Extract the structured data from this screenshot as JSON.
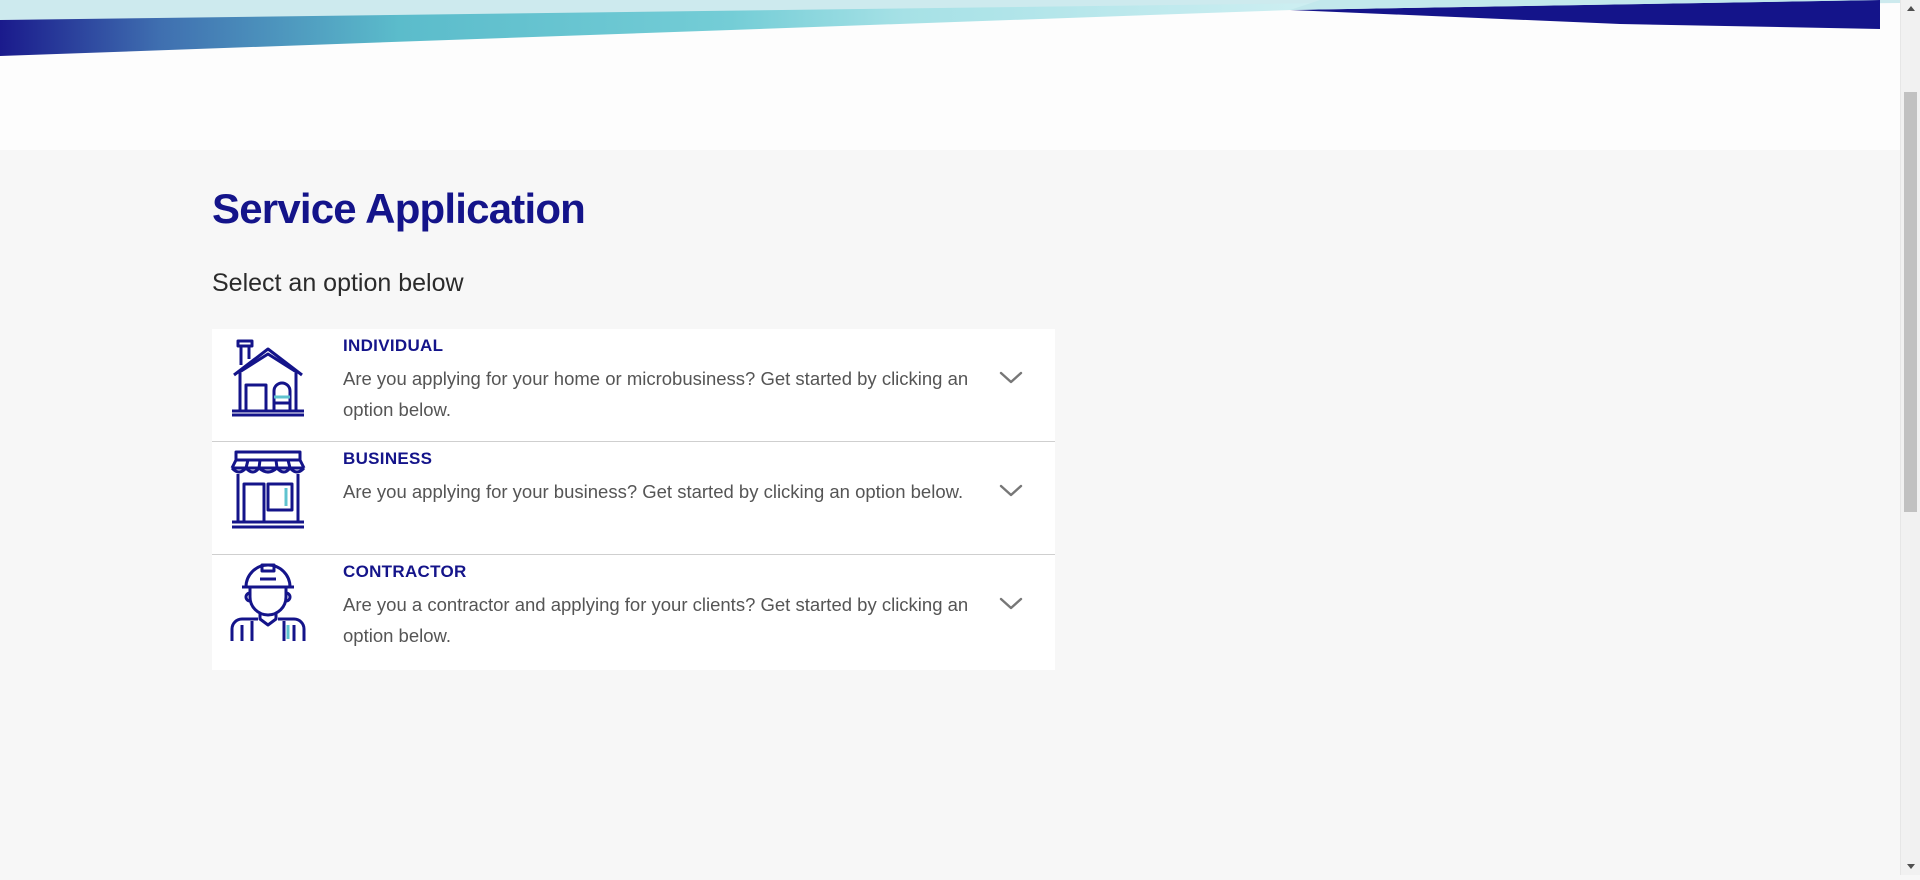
{
  "page": {
    "title": "Service Application",
    "subtitle": "Select an option below"
  },
  "options": [
    {
      "label": "INDIVIDUAL",
      "description": "Are you applying for your home or microbusiness? Get started by clicking an option below.",
      "icon": "house-icon"
    },
    {
      "label": "BUSINESS",
      "description": "Are you applying for your business? Get started by clicking an option below.",
      "icon": "storefront-icon"
    },
    {
      "label": "CONTRACTOR",
      "description": "Are you a contractor and applying for your clients? Get started by clicking an option below.",
      "icon": "contractor-icon"
    }
  ],
  "colors": {
    "brand_navy": "#14148a",
    "accent_teal": "#5fc3cf",
    "background": "#f7f7f7",
    "body_text": "#555555"
  }
}
